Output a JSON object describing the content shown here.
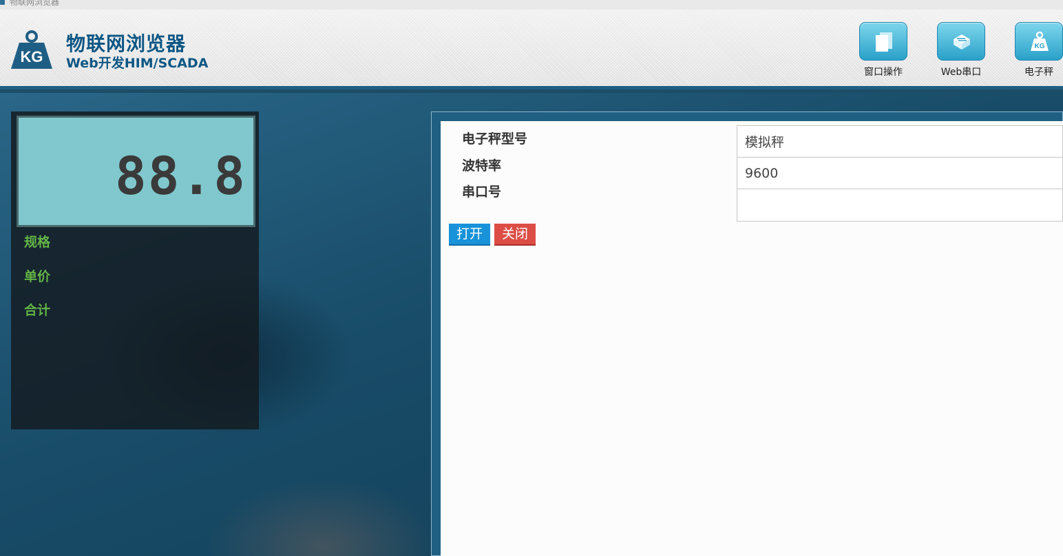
{
  "window": {
    "title": "物联网浏览器"
  },
  "brand": {
    "logo_text": "KG",
    "title": "物联网浏览器",
    "subtitle": "Web开发HIM/SCADA"
  },
  "toolbar": {
    "items": [
      {
        "label": "窗口操作",
        "icon": "window-pages-icon"
      },
      {
        "label": "Web串口",
        "icon": "serial-port-icon"
      },
      {
        "label": "电子秤",
        "icon": "kg-weight-icon"
      }
    ]
  },
  "scale": {
    "display_value": "88.8",
    "fields": [
      {
        "label": "规格"
      },
      {
        "label": "单价"
      },
      {
        "label": "合计"
      }
    ]
  },
  "form": {
    "fields": [
      {
        "label": "电子秤型号",
        "value": "模拟秤"
      },
      {
        "label": "波特率",
        "value": "9600"
      },
      {
        "label": "串口号",
        "value": ""
      }
    ],
    "open_label": "打开",
    "close_label": "关闭"
  },
  "colors": {
    "brand_blue": "#0e5784",
    "lcd_background": "#80c8cd",
    "field_label_green": "#63b347",
    "open_button": "#1892d8",
    "close_button": "#dc4d46"
  }
}
